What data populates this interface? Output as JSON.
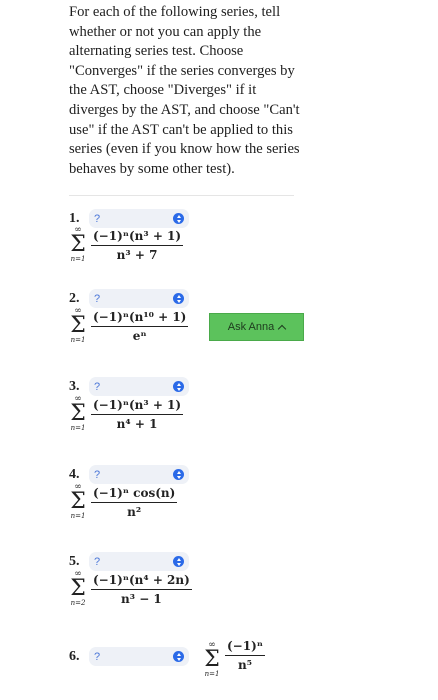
{
  "instructions": "For each of the following series, tell whether or not you can apply the alternating series test. Choose \"Converges\" if the series converges by the AST, choose \"Diverges\" if it diverges by the AST, and choose \"Can't use\" if the AST can't be applied to this series (even if you know how the series behaves by some other test).",
  "select_placeholder": "?",
  "ask_button": "Ask Anna",
  "sum_top": "∞",
  "questions": [
    {
      "number": "1.",
      "lower": "n=1",
      "numerator": "(−1)ⁿ(n³ + 1)",
      "denominator": "n³ + 7"
    },
    {
      "number": "2.",
      "lower": "n=1",
      "numerator": "(−1)ⁿ(n¹⁰ + 1)",
      "denominator": "eⁿ"
    },
    {
      "number": "3.",
      "lower": "n=1",
      "numerator": "(−1)ⁿ(n³ + 1)",
      "denominator": "n⁴ + 1"
    },
    {
      "number": "4.",
      "lower": "n=1",
      "numerator": "(−1)ⁿ cos(n)",
      "denominator": "n²"
    },
    {
      "number": "5.",
      "lower": "n=2",
      "numerator": "(−1)ⁿ(n⁴ + 2n)",
      "denominator": "n³ − 1"
    },
    {
      "number": "6.",
      "lower": "n=1",
      "numerator": "(−1)ⁿ",
      "denominator": "n⁵"
    }
  ]
}
